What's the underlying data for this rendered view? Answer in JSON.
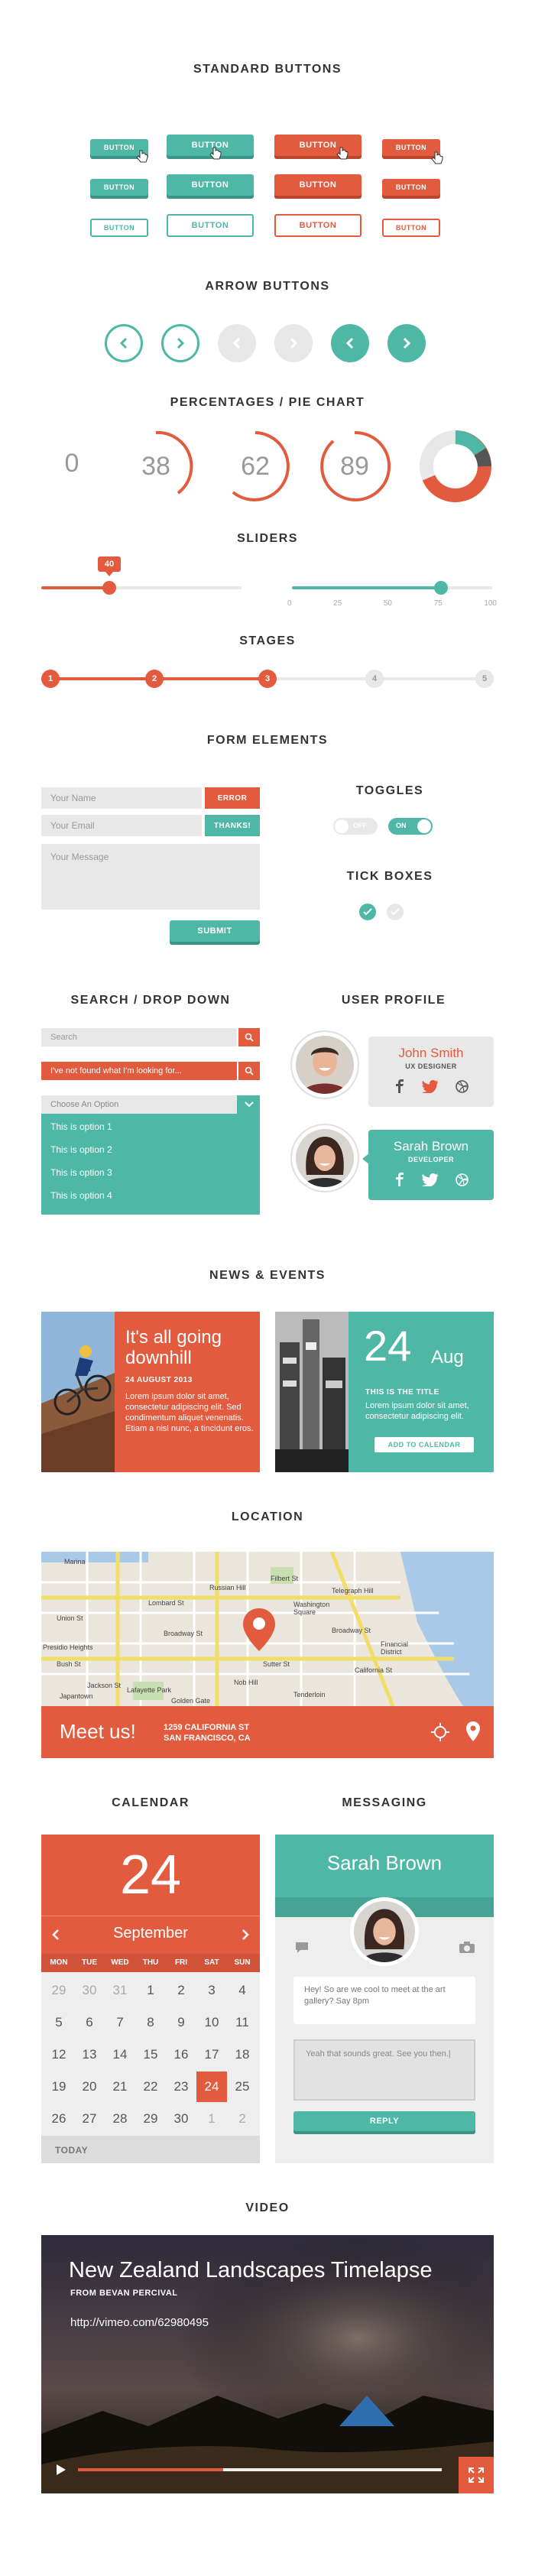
{
  "sections": {
    "standard_buttons": "STANDARD BUTTONS",
    "arrow_buttons": "ARROW BUTTONS",
    "percentages": "PERCENTAGES / PIE CHART",
    "sliders": "SLIDERS",
    "stages": "STAGES",
    "form_elements": "FORM ELEMENTS",
    "search_dropdown": "SEARCH / DROP DOWN",
    "user_profile": "USER PROFILE",
    "news_events": "NEWS & EVENTS",
    "location": "LOCATION",
    "calendar": "CALENDAR",
    "messaging": "MESSAGING",
    "video": "VIDEO"
  },
  "buttons": {
    "label": "BUTTON"
  },
  "colors": {
    "teal": "#4fb7a6",
    "orange": "#e35b3e",
    "grey": "#e8e8e8"
  },
  "percentages": {
    "values": [
      "0",
      "38",
      "62",
      "89"
    ],
    "pie_fraction": 0.72
  },
  "sliders": {
    "value_badge": "40",
    "value1": 0.4,
    "value2": 0.75,
    "ticks": [
      "0",
      "25",
      "50",
      "75",
      "100"
    ]
  },
  "stages": {
    "labels": [
      "1",
      "2",
      "3",
      "4",
      "5"
    ],
    "current": 3
  },
  "form": {
    "name_placeholder": "Your Name",
    "name_badge": "ERROR",
    "email_placeholder": "Your Email",
    "email_badge": "THANKS!",
    "message_placeholder": "Your Message",
    "submit": "SUBMIT",
    "toggles_title": "TOGGLES",
    "toggle_off": "OFF",
    "toggle_on": "ON",
    "tick_title": "TICK BOXES"
  },
  "search": {
    "placeholder": "Search",
    "error_text": "I've not found what I'm looking for...",
    "dropdown_label": "Choose An Option",
    "options": [
      "This is option 1",
      "This is option 2",
      "This is option 3",
      "This is option 4"
    ]
  },
  "profiles": [
    {
      "name": "John Smith",
      "role": "UX DESIGNER"
    },
    {
      "name": "Sarah Brown",
      "role": "DEVELOPER"
    }
  ],
  "news": {
    "title": "It's all going downhill",
    "date": "24 AUGUST 2013",
    "body": "Lorem ipsum dolor sit amet, consectetur adipiscing elit. Sed condimentum aliquet venenatis. Etiam a nisl nunc, a tincidunt eros.",
    "event_day": "24",
    "event_month": "Aug",
    "event_title": "THIS IS THE TITLE",
    "event_body": "Lorem ipsum dolor sit amet, consectetur adipiscing elit.",
    "event_button": "ADD TO CALENDAR"
  },
  "location": {
    "cta": "Meet us!",
    "address1": "1259 CALIFORNIA ST",
    "address2": "SAN FRANCISCO, CA",
    "map_labels": [
      "Marina",
      "Russian Hill",
      "Lombard St",
      "Telegraph Hill",
      "Filbert St",
      "Union St",
      "Washington Square",
      "Broadway St",
      "Broadway St",
      "Financial District",
      "California St",
      "Nob Hill",
      "Lafayette Park",
      "Tenderloin",
      "Jackson St",
      "Sutter St",
      "Bush St",
      "Japantown",
      "Golden Gate",
      "Presidio Heights"
    ]
  },
  "calendar": {
    "day": "24",
    "month": "September",
    "dow": [
      "MON",
      "TUE",
      "WED",
      "THU",
      "FRI",
      "SAT",
      "SUN"
    ],
    "weeks": [
      [
        "29",
        "30",
        "31",
        "1",
        "2",
        "3",
        "4"
      ],
      [
        "5",
        "6",
        "7",
        "8",
        "9",
        "10",
        "11"
      ],
      [
        "12",
        "13",
        "14",
        "15",
        "16",
        "17",
        "18"
      ],
      [
        "19",
        "20",
        "21",
        "22",
        "23",
        "24",
        "25"
      ],
      [
        "26",
        "27",
        "28",
        "29",
        "30",
        "1",
        "2"
      ]
    ],
    "today": "TODAY"
  },
  "messaging": {
    "name": "Sarah Brown",
    "received": "Hey! So are we cool to meet at the art gallery? Say 8pm",
    "reply_text": "Yeah that sounds great. See you then.|",
    "reply_button": "REPLY"
  },
  "video": {
    "title": "New Zealand Landscapes Timelapse",
    "author": "FROM BEVAN PERCIVAL",
    "url": "http://vimeo.com/62980495",
    "progress": 0.4
  }
}
